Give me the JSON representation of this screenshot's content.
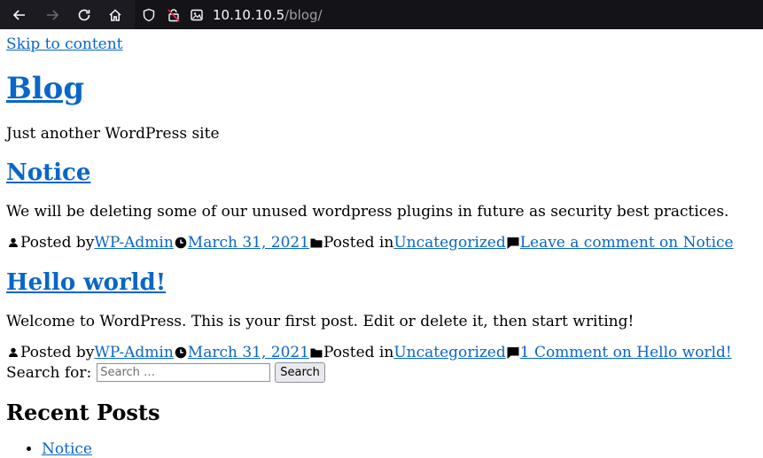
{
  "browser": {
    "url_host": "10.10.10.5",
    "url_path": "/blog/",
    "icons": [
      "back-icon",
      "forward-icon",
      "reload-icon",
      "home-icon",
      "shield-icon",
      "insecure-lock-icon",
      "page-icon"
    ]
  },
  "site": {
    "skip_link": "Skip to content",
    "title": "Blog",
    "tagline": "Just another WordPress site"
  },
  "posts": [
    {
      "title": "Notice",
      "excerpt": "We will be deleting some of our unused wordpress plugins in future as security best practices.",
      "posted_by_label": "Posted by",
      "author": "WP-Admin",
      "date": "March 31, 2021",
      "posted_in_label": "Posted in",
      "category": "Uncategorized",
      "comment_link": "Leave a comment on Notice"
    },
    {
      "title": "Hello world!",
      "excerpt": "Welcome to WordPress. This is your first post. Edit or delete it, then start writing!",
      "posted_by_label": "Posted by",
      "author": "WP-Admin",
      "date": "March 31, 2021",
      "posted_in_label": "Posted in",
      "category": "Uncategorized",
      "comment_link": "1 Comment on Hello world!"
    }
  ],
  "search": {
    "label": "Search for:",
    "placeholder": "Search …",
    "button": "Search"
  },
  "recent_posts": {
    "title": "Recent Posts",
    "items": [
      "Notice"
    ]
  }
}
